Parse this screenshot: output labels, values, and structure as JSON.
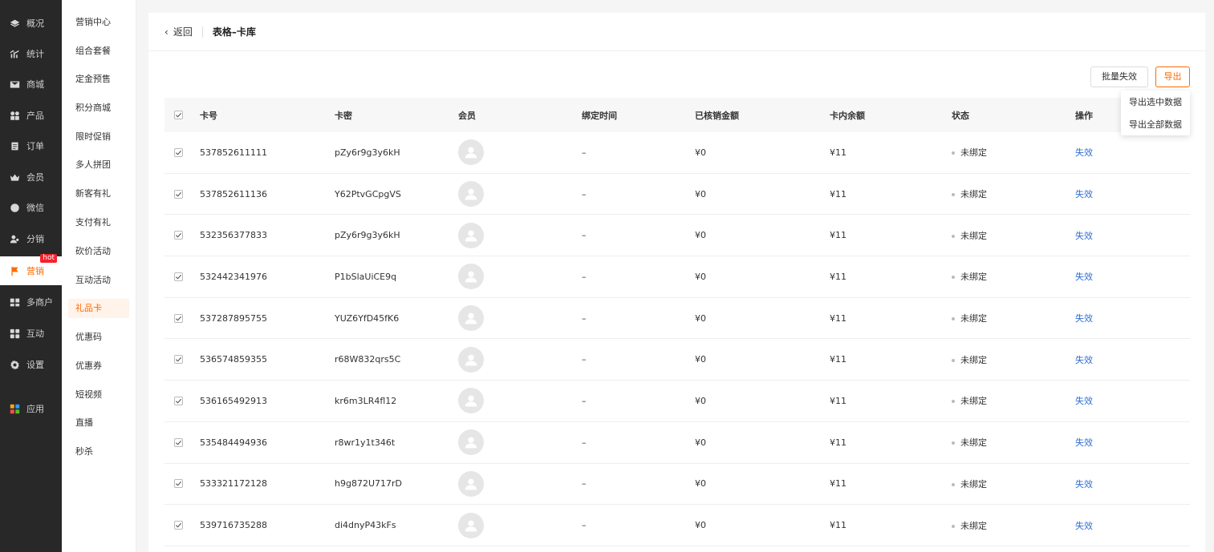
{
  "nav1": {
    "items": [
      {
        "label": "概况",
        "icon": "layers-icon"
      },
      {
        "label": "统计",
        "icon": "chart-icon"
      },
      {
        "label": "商城",
        "icon": "mail-icon"
      },
      {
        "label": "产品",
        "icon": "grid-icon"
      },
      {
        "label": "订单",
        "icon": "clipboard-icon"
      },
      {
        "label": "会员",
        "icon": "crown-icon"
      },
      {
        "label": "微信",
        "icon": "wechat-icon"
      },
      {
        "label": "分销",
        "icon": "users-icon"
      },
      {
        "label": "营销",
        "icon": "flag-icon",
        "badge": "hot"
      },
      {
        "label": "多商户",
        "icon": "store-icon"
      },
      {
        "label": "互动",
        "icon": "tiles-icon"
      },
      {
        "label": "设置",
        "icon": "gear-icon"
      },
      {
        "label": "应用",
        "icon": "apps-icon"
      }
    ]
  },
  "nav2": {
    "items": [
      "营销中心",
      "组合套餐",
      "定金预售",
      "积分商城",
      "限时促销",
      "多人拼团",
      "新客有礼",
      "支付有礼",
      "砍价活动",
      "互动活动",
      "礼品卡",
      "优惠码",
      "优惠券",
      "短视频",
      "直播",
      "秒杀"
    ]
  },
  "header": {
    "back_label": "返回",
    "title": "表格–卡库"
  },
  "toolbar": {
    "batch_label": "批量失效",
    "export_label": "导出"
  },
  "export_menu": {
    "selected": "导出选中数据",
    "all": "导出全部数据"
  },
  "table": {
    "headers": {
      "card": "卡号",
      "pwd": "卡密",
      "member": "会员",
      "bind": "绑定时间",
      "used": "已核销金额",
      "balance": "卡内余额",
      "status": "状态",
      "op": "操作"
    },
    "rows": [
      {
        "card": "537852611111",
        "pwd": "pZy6r9g3y6kH",
        "bind": "–",
        "used": "¥0",
        "balance": "¥11",
        "status": "未绑定",
        "op": "失效"
      },
      {
        "card": "537852611136",
        "pwd": "Y62PtvGCpgVS",
        "bind": "–",
        "used": "¥0",
        "balance": "¥11",
        "status": "未绑定",
        "op": "失效"
      },
      {
        "card": "532356377833",
        "pwd": "pZy6r9g3y6kH",
        "bind": "–",
        "used": "¥0",
        "balance": "¥11",
        "status": "未绑定",
        "op": "失效"
      },
      {
        "card": "532442341976",
        "pwd": "P1bSlaUiCE9q",
        "bind": "–",
        "used": "¥0",
        "balance": "¥11",
        "status": "未绑定",
        "op": "失效"
      },
      {
        "card": "537287895755",
        "pwd": "YUZ6YfD45fK6",
        "bind": "–",
        "used": "¥0",
        "balance": "¥11",
        "status": "未绑定",
        "op": "失效"
      },
      {
        "card": "536574859355",
        "pwd": "r68W832qrs5C",
        "bind": "–",
        "used": "¥0",
        "balance": "¥11",
        "status": "未绑定",
        "op": "失效"
      },
      {
        "card": "536165492913",
        "pwd": "kr6m3LR4fl12",
        "bind": "–",
        "used": "¥0",
        "balance": "¥11",
        "status": "未绑定",
        "op": "失效"
      },
      {
        "card": "535484494936",
        "pwd": "r8wr1y1t346t",
        "bind": "–",
        "used": "¥0",
        "balance": "¥11",
        "status": "未绑定",
        "op": "失效"
      },
      {
        "card": "533321172128",
        "pwd": "h9g872U717rD",
        "bind": "–",
        "used": "¥0",
        "balance": "¥11",
        "status": "未绑定",
        "op": "失效"
      },
      {
        "card": "539716735288",
        "pwd": "di4dnyP43kFs",
        "bind": "–",
        "used": "¥0",
        "balance": "¥11",
        "status": "未绑定",
        "op": "失效"
      }
    ]
  },
  "colors": {
    "accent": "#ff6a00",
    "link": "#2f6dd3",
    "sidebar": "#282828"
  }
}
